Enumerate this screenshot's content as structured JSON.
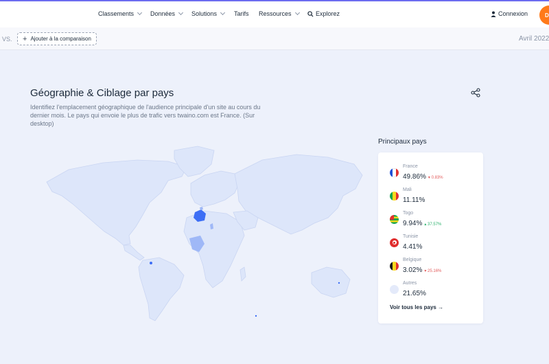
{
  "nav": {
    "items": [
      {
        "label": "Classements",
        "dropdown": true
      },
      {
        "label": "Données",
        "dropdown": true
      },
      {
        "label": "Solutions",
        "dropdown": true
      },
      {
        "label": "Tarifs",
        "dropdown": false
      },
      {
        "label": "Ressources",
        "dropdown": true
      }
    ],
    "explore_label": "Explorez",
    "login_label": "Connexion",
    "avatar_letter": "D",
    "accent_color": "#ff7a1a"
  },
  "compare": {
    "vs_label": "VS.",
    "add_label": "Ajouter à la comparaison",
    "period": "Avril 2022"
  },
  "section": {
    "title": "Géographie & Ciblage par pays",
    "description": "Identifiez l'emplacement géographique de l'audience principale d'un site au cours du dernier mois. Le pays qui envoie le plus de trafic vers twaino.com est France. (Sur desktop)"
  },
  "top_countries": {
    "title": "Principaux pays",
    "countries": [
      {
        "name": "France",
        "share": "49.86%",
        "change": "0.83%",
        "direction": "down",
        "flag": "france-flag-icon"
      },
      {
        "name": "Mali",
        "share": "11.11%",
        "change": "",
        "direction": "none",
        "flag": "mali-flag-icon"
      },
      {
        "name": "Togo",
        "share": "9.94%",
        "change": "37.57%",
        "direction": "up",
        "flag": "togo-flag-icon"
      },
      {
        "name": "Tunisie",
        "share": "4.41%",
        "change": "",
        "direction": "none",
        "flag": "tunisia-flag-icon"
      },
      {
        "name": "Belgique",
        "share": "3.02%",
        "change": "25.16%",
        "direction": "down",
        "flag": "belgium-flag-icon"
      },
      {
        "name": "Autres",
        "share": "21.65%",
        "change": "",
        "direction": "none",
        "flag": "others-icon"
      }
    ],
    "see_all_label": "Voir tous les pays →"
  },
  "colors": {
    "map_land": "#dde6fa",
    "map_highlight": "#3d6ef5",
    "map_medium": "#9fb8f7",
    "up": "#2fb36f",
    "down": "#e35d5d"
  }
}
